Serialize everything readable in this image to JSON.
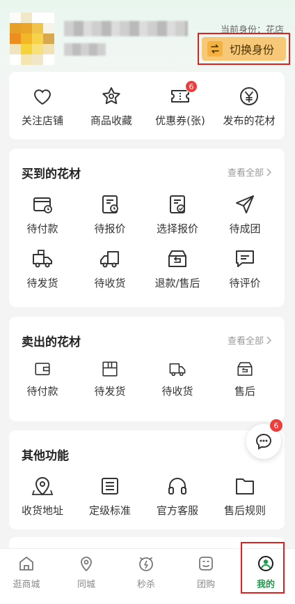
{
  "header": {
    "identity_text": "当前身份：花店",
    "switch_label": "切换身份"
  },
  "quick": {
    "items": [
      {
        "label": "关注店铺",
        "icon": "heart-icon"
      },
      {
        "label": "商品收藏",
        "icon": "star-icon"
      },
      {
        "label": "优惠券(张)",
        "icon": "coupon-icon",
        "badge": "6"
      },
      {
        "label": "发布的花材",
        "icon": "yen-icon"
      }
    ]
  },
  "bought": {
    "title": "买到的花材",
    "view_all": "查看全部",
    "items": [
      {
        "label": "待付款",
        "icon": "pay-card-icon"
      },
      {
        "label": "待报价",
        "icon": "quote-clock-icon"
      },
      {
        "label": "选择报价",
        "icon": "select-quote-icon"
      },
      {
        "label": "待成团",
        "icon": "send-plane-icon"
      },
      {
        "label": "待发货",
        "icon": "truck-box-icon"
      },
      {
        "label": "待收货",
        "icon": "truck-icon"
      },
      {
        "label": "退款/售后",
        "icon": "refund-box-icon"
      },
      {
        "label": "待评价",
        "icon": "comment-icon"
      }
    ]
  },
  "sold": {
    "title": "卖出的花材",
    "view_all": "查看全部",
    "items": [
      {
        "label": "待付款",
        "icon": "wallet-icon"
      },
      {
        "label": "待发货",
        "icon": "package-icon"
      },
      {
        "label": "待收货",
        "icon": "delivery-icon"
      },
      {
        "label": "售后",
        "icon": "aftersale-box-icon"
      }
    ]
  },
  "other": {
    "title": "其他功能",
    "items": [
      {
        "label": "收货地址",
        "icon": "map-pin-icon"
      },
      {
        "label": "定级标准",
        "icon": "list-doc-icon"
      },
      {
        "label": "官方客服",
        "icon": "headphones-icon"
      },
      {
        "label": "售后规则",
        "icon": "folder-icon"
      }
    ]
  },
  "chat_badge": "6",
  "tabbar": {
    "tabs": [
      {
        "label": "逛商城",
        "icon": "home-icon"
      },
      {
        "label": "同城",
        "icon": "location-icon"
      },
      {
        "label": "秒杀",
        "icon": "flash-clock-icon"
      },
      {
        "label": "团购",
        "icon": "group-buy-icon"
      },
      {
        "label": "我的",
        "icon": "profile-icon",
        "active": true
      }
    ]
  },
  "colors": {
    "accent_green": "#1a9d4a",
    "badge_red": "#ee3b3b",
    "switch_bg": "#f7c878"
  }
}
